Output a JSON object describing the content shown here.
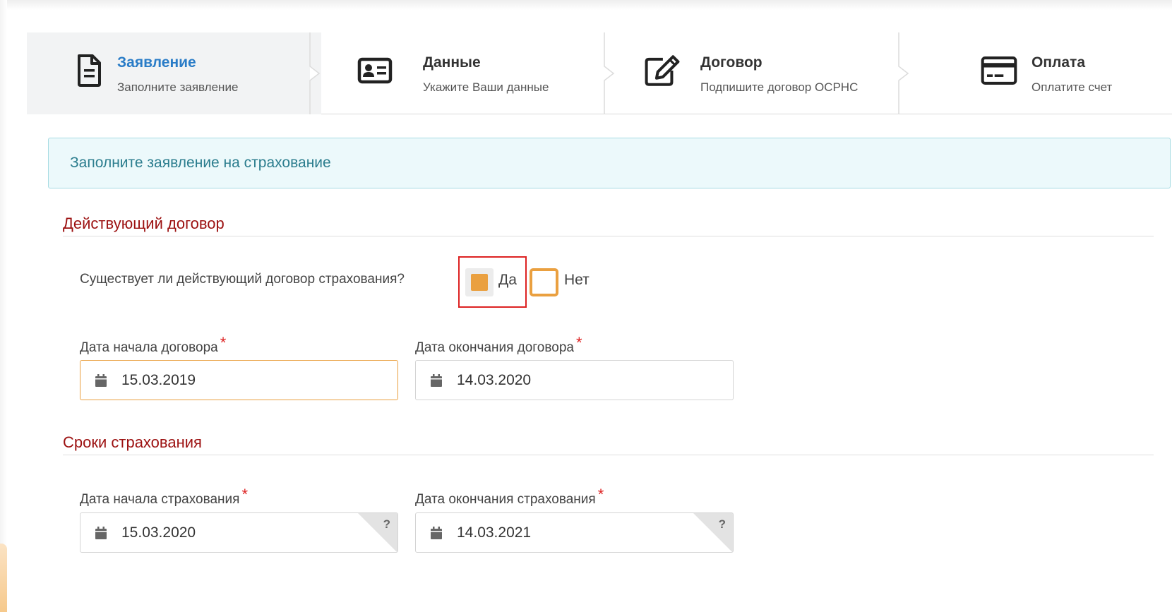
{
  "steps": [
    {
      "title": "Заявление",
      "subtitle": "Заполните заявление",
      "icon": "document-icon",
      "active": true
    },
    {
      "title": "Данные",
      "subtitle": "Укажите Ваши данные",
      "icon": "id-card-icon",
      "active": false
    },
    {
      "title": "Договор",
      "subtitle": "Подпишите договор ОСРНС",
      "icon": "edit-icon",
      "active": false
    },
    {
      "title": "Оплата",
      "subtitle": "Оплатите счет",
      "icon": "credit-card-icon",
      "active": false
    }
  ],
  "alert": {
    "text": "Заполните заявление на страхование"
  },
  "current_contract": {
    "section_title": "Действующий договор",
    "question": "Существует ли действующий договор страхования?",
    "options": {
      "yes": "Да",
      "no": "Нет"
    },
    "selected": "yes",
    "start": {
      "label": "Дата начала договора",
      "value": "15.03.2019",
      "required": "*"
    },
    "end": {
      "label": "Дата окончания договора",
      "value": "14.03.2020",
      "required": "*"
    }
  },
  "insurance_period": {
    "section_title": "Сроки страхования",
    "start": {
      "label": "Дата начала страхования",
      "value": "15.03.2020",
      "required": "*",
      "hint": "?"
    },
    "end": {
      "label": "Дата окончания страхования",
      "value": "14.03.2021",
      "required": "*",
      "hint": "?"
    }
  },
  "colors": {
    "accent": "#eaa040",
    "active_step": "#2a7cc7",
    "section": "#9c1111",
    "alert_bg": "#ecf9fb",
    "highlight": "#dd2222"
  }
}
